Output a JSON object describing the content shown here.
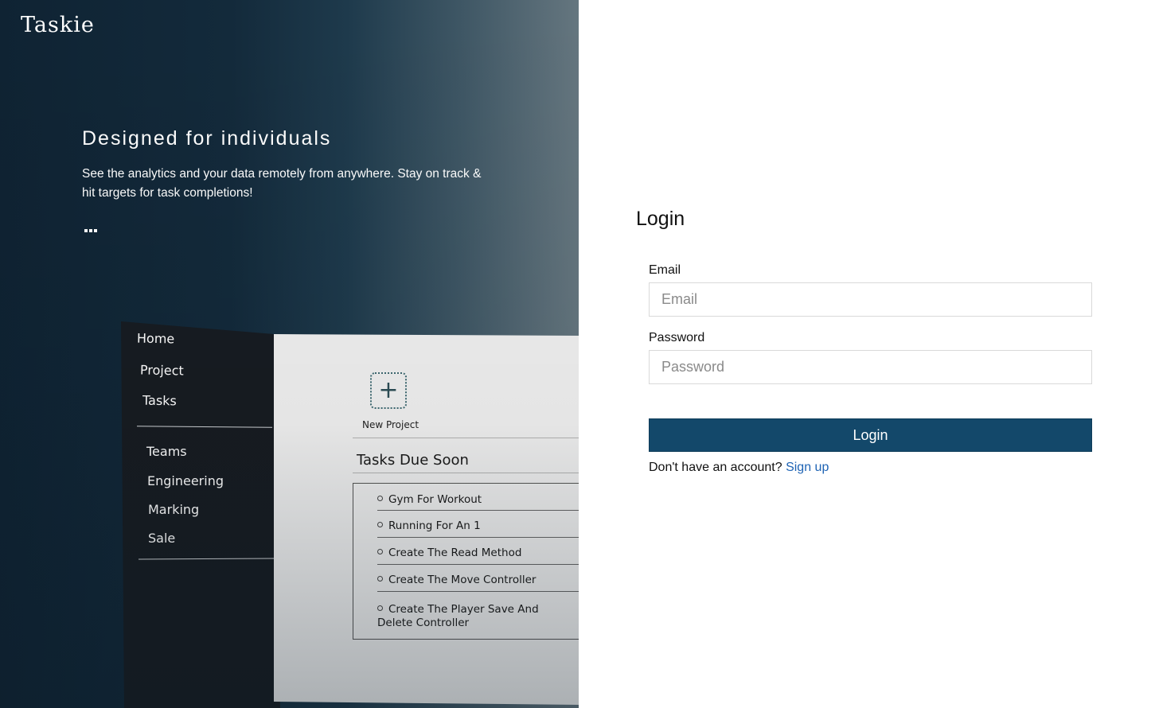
{
  "brand": {
    "name": "Taskie"
  },
  "hero": {
    "title": "Designed for individuals",
    "description": "See the analytics and your data remotely from anywhere. Stay on track & hit targets for task completions!",
    "carousel_indicator": "..."
  },
  "preview": {
    "nav_primary": [
      "Home",
      "Project",
      "Tasks"
    ],
    "nav_secondary": [
      "Teams",
      "Engineering",
      "Marking",
      "Sale"
    ],
    "new_project_icon": "plus-icon",
    "new_project_label": "New Project",
    "tasks_title": "Tasks Due Soon",
    "tasks": [
      "Gym For Workout",
      "Running For An 1",
      "Create The Read Method",
      "Create The Move Controller",
      "Create The Player Save And Delete Controller"
    ]
  },
  "login": {
    "title": "Login",
    "email_label": "Email",
    "email_placeholder": "Email",
    "email_value": "",
    "password_label": "Password",
    "password_placeholder": "Password",
    "password_value": "",
    "submit_label": "Login",
    "signup_prompt": "Don't have an account?",
    "signup_link": "Sign up"
  },
  "colors": {
    "hero_dark": "#0f2333",
    "hero_light": "#65767f",
    "button_bg": "#13486a",
    "link": "#1e63b4"
  }
}
